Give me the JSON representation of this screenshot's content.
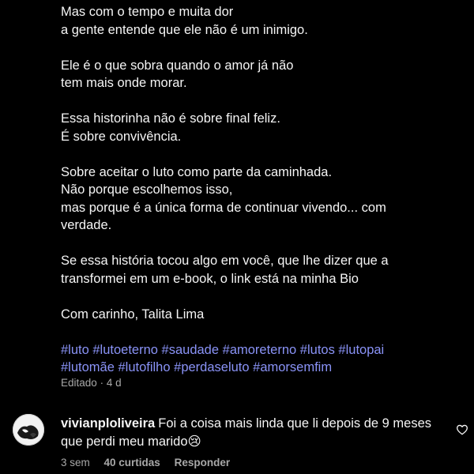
{
  "caption": {
    "paragraphs": [
      [
        "Mas com o tempo e muita dor",
        "a gente entende que ele não é um inimigo."
      ],
      [
        "Ele é o que sobra quando o amor já não",
        "tem mais onde morar."
      ],
      [
        "Essa historinha não é sobre final feliz.",
        "É sobre convivência."
      ],
      [
        "Sobre aceitar o luto como parte da caminhada.",
        "Não porque escolhemos isso,",
        "mas porque é a única forma de continuar vivendo... com",
        "verdade."
      ],
      [
        "Se essa história tocou algo em você, que lhe dizer que a",
        "transformei em um e-book, o link está na minha Bio"
      ],
      [
        "Com carinho, Talita Lima"
      ]
    ],
    "hashtags": [
      "#luto",
      "#lutoeterno",
      "#saudade",
      "#amoreterno",
      "#lutos",
      "#lutopai",
      "#lutomãe",
      "#lutofilho",
      "#perdaseluto",
      "#amorsemfim"
    ]
  },
  "caption_meta": {
    "edited": "Editado",
    "separator": "·",
    "time": "4 d"
  },
  "comment": {
    "username": "vivianploliveira",
    "text": "Foi a coisa mais linda que li depois de 9 meses que perdi meu marido",
    "emoji": "😢",
    "time": "3 sem",
    "likes": "40 curtidas",
    "reply": "Responder",
    "heart_icon": "heart-outline-icon"
  },
  "colors": {
    "background": "#000000",
    "text": "#f5f5f5",
    "muted": "#a8a8a8",
    "hashtag": "#8a93f7"
  }
}
